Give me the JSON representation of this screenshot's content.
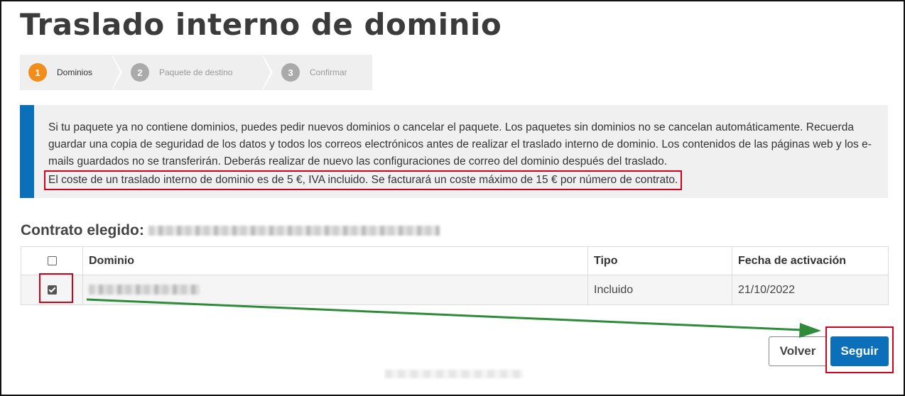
{
  "page": {
    "title": "Traslado interno de dominio"
  },
  "stepper": {
    "steps": [
      {
        "number": "1",
        "label": "Dominios",
        "state": "active"
      },
      {
        "number": "2",
        "label": "Paquete de destino",
        "state": "inactive"
      },
      {
        "number": "3",
        "label": "Confirmar",
        "state": "inactive"
      }
    ]
  },
  "info": {
    "text": "Si tu paquete ya no contiene dominios, puedes pedir nuevos dominios o cancelar el paquete. Los paquetes sin dominios no se cancelan automáticamente. Recuerda guardar una copia de seguridad de los datos y todos los correos electrónicos antes de realizar el traslado interno de dominio. Los contenidos de las páginas web y los e-mails guardados no se transferirán. Deberás realizar de nuevo las configuraciones de correo del dominio después del traslado.",
    "cost_note": "El coste de un traslado interno de dominio es de 5 €, IVA incluido. Se facturará un coste máximo de 15 € por número de contrato."
  },
  "contract": {
    "label": "Contrato elegido:"
  },
  "table": {
    "headers": {
      "domain": "Dominio",
      "type": "Tipo",
      "activation": "Fecha de activación"
    },
    "header_checked": false,
    "rows": [
      {
        "checked": true,
        "type": "Incluido",
        "activation": "21/10/2022"
      }
    ]
  },
  "actions": {
    "back_label": "Volver",
    "next_label": "Seguir"
  },
  "colors": {
    "accent_blue": "#0b6fb9",
    "step_active": "#f28c1b",
    "annotation_red": "#d0021b",
    "annotation_green": "#2e8b3a"
  }
}
